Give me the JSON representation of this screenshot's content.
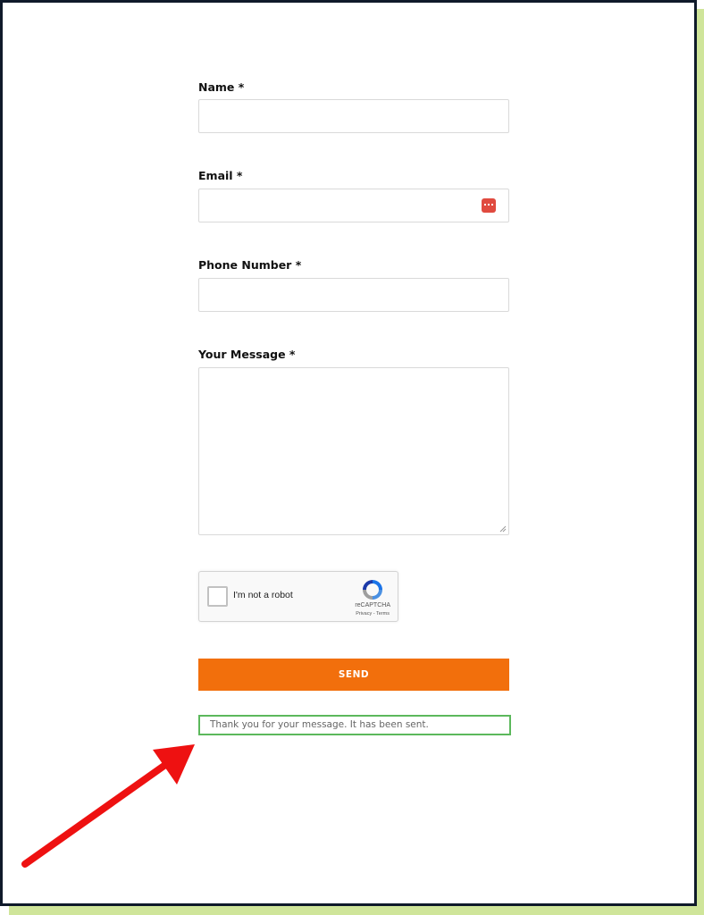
{
  "form": {
    "name_label": "Name *",
    "email_label": "Email *",
    "phone_label": "Phone Number *",
    "message_label": "Your Message *",
    "name_value": "",
    "email_value": "",
    "phone_value": "",
    "message_value": ""
  },
  "captcha": {
    "label": "I'm not a robot",
    "brand": "reCAPTCHA",
    "links": "Privacy - Terms"
  },
  "send_button": {
    "label": "SEND"
  },
  "success_message": "Thank you for your message. It has been sent.",
  "colors": {
    "send_button": "#f26f0c",
    "success_border": "#5cb85c",
    "annotation_arrow": "#ee1111",
    "frame_shadow": "#cfe59a"
  },
  "icons": {
    "password_manager": "password-manager-icon",
    "recaptcha": "recaptcha-logo-icon",
    "annotation": "red-arrow-annotation"
  }
}
